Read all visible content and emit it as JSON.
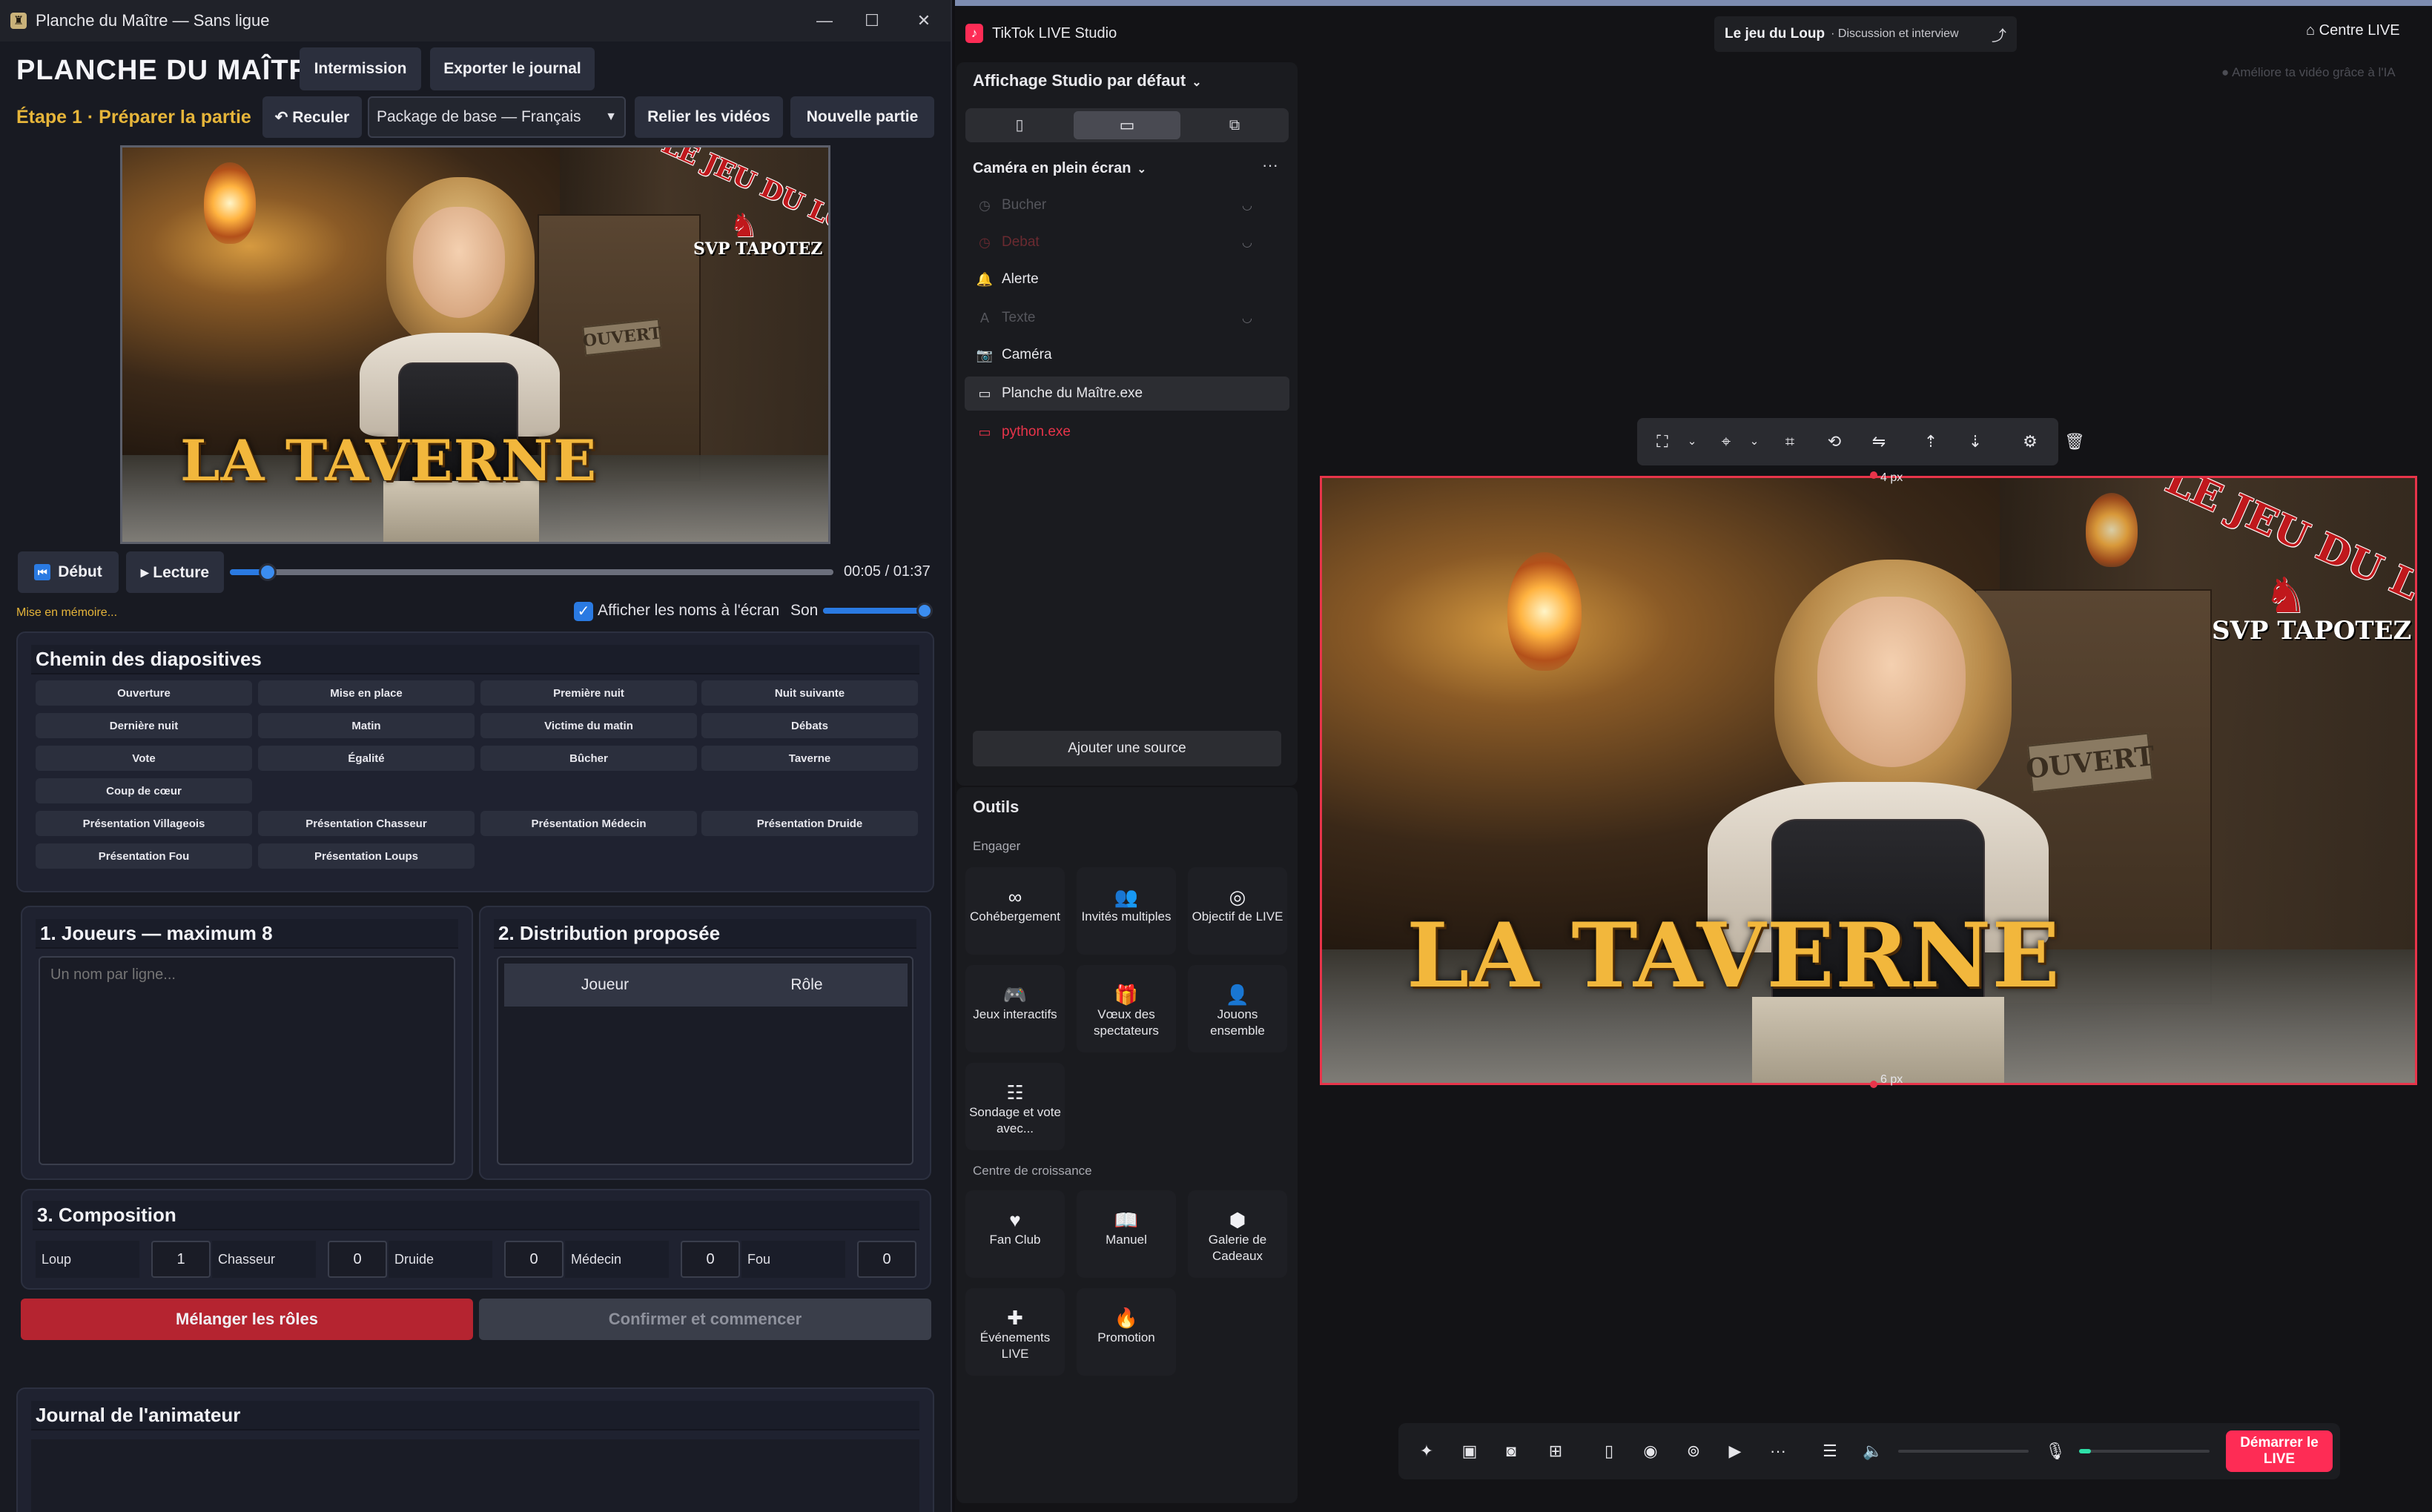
{
  "left_app": {
    "window_title": "Planche du Maître — Sans ligue",
    "logo_glyph": "♜",
    "win_controls": {
      "minimize": "—",
      "maximize": "☐",
      "close": "✕"
    },
    "app_title": "PLANCHE DU MAÎTRE",
    "buttons": {
      "intermission": "Intermission",
      "export_log": "Exporter le journal",
      "back": "↶ Reculer",
      "link_videos": "Relier les vidéos",
      "new_game": "Nouvelle partie",
      "start": "Début",
      "play": "▸ Lecture",
      "shuffle_roles": "Mélanger les rôles",
      "confirm_start": "Confirmer et commencer"
    },
    "step_label": "Étape 1 · Préparer la partie",
    "package_select": "Package de base — Français",
    "video": {
      "title": "LA TAVERNE",
      "logo_line1": "LE JEU DU LOUP",
      "logo_line2": "SVP TAPOTEZ",
      "sign": "OUVERT",
      "time": "00:05 / 01:37",
      "progress_fraction": 0.063
    },
    "memory_label": "Mise en mémoire...",
    "show_names_label": "Afficher les noms à l'écran",
    "show_names_checked": true,
    "sound_label": "Son",
    "sound_level": 1.0,
    "slides": {
      "title": "Chemin des diapositives",
      "items": [
        "Ouverture",
        "Mise en place",
        "Première nuit",
        "Nuit suivante",
        "Dernière nuit",
        "Matin",
        "Victime du matin",
        "Débats",
        "Vote",
        "Égalité",
        "Bûcher",
        "Taverne",
        "Coup de cœur",
        "Présentation Villageois",
        "Présentation Chasseur",
        "Présentation Médecin",
        "Présentation Druide",
        "Présentation Fou",
        "Présentation Loups"
      ]
    },
    "players": {
      "title": "1. Joueurs — maximum 8",
      "placeholder": "Un nom par ligne..."
    },
    "distribution": {
      "title": "2. Distribution proposée",
      "columns": [
        "Joueur",
        "Rôle"
      ]
    },
    "composition": {
      "title": "3. Composition",
      "roles": [
        {
          "name": "Loup",
          "value": "1"
        },
        {
          "name": "Chasseur",
          "value": "0"
        },
        {
          "name": "Druide",
          "value": "0"
        },
        {
          "name": "Médecin",
          "value": "0"
        },
        {
          "name": "Fou",
          "value": "0"
        }
      ]
    },
    "log": {
      "title": "Journal de l'animateur"
    }
  },
  "right_app": {
    "title": "TikTok LIVE Studio",
    "stream_title": "Le jeu du Loup",
    "stream_category": "· Discussion et interview",
    "live_center": "Centre LIVE",
    "ai_hint": "Améliore ta vidéo grâce à l'IA",
    "layout_select": "Affichage Studio par défaut",
    "scene_select": "Caméra en plein écran",
    "sources": [
      {
        "label": "Bucher",
        "icon": "◷",
        "dim": true
      },
      {
        "label": "Debat",
        "icon": "◷",
        "dim": true
      },
      {
        "label": "Alerte",
        "icon": "🔔",
        "dim": false
      },
      {
        "label": "Texte",
        "icon": "A",
        "dim": true
      },
      {
        "label": "Caméra",
        "icon": "📷",
        "dim": false
      },
      {
        "label": "Planche du Maître.exe",
        "icon": "▭",
        "dim": false
      },
      {
        "label": "python.exe",
        "icon": "▭",
        "dim": false
      }
    ],
    "add_source": "Ajouter une source",
    "tools_title": "Outils",
    "engage_label": "Engager",
    "engage_tools": [
      "Cohébergement",
      "Invités multiples",
      "Objectif de LIVE",
      "Jeux interactifs",
      "Vœux des spectateurs",
      "Jouons ensemble",
      "Sondage et vote avec..."
    ],
    "growth_label": "Centre de croissance",
    "growth_tools": [
      "Fan Club",
      "Manuel",
      "Galerie de Cadeaux",
      "Événements LIVE",
      "Promotion"
    ],
    "preview": {
      "top_margin": "4 px",
      "bottom_margin": "6 px"
    },
    "mic_level": 0.09,
    "go_live": "Démarrer le LIVE",
    "colors": {
      "accent": "#fe2c55",
      "selection": "#e8344a"
    }
  }
}
